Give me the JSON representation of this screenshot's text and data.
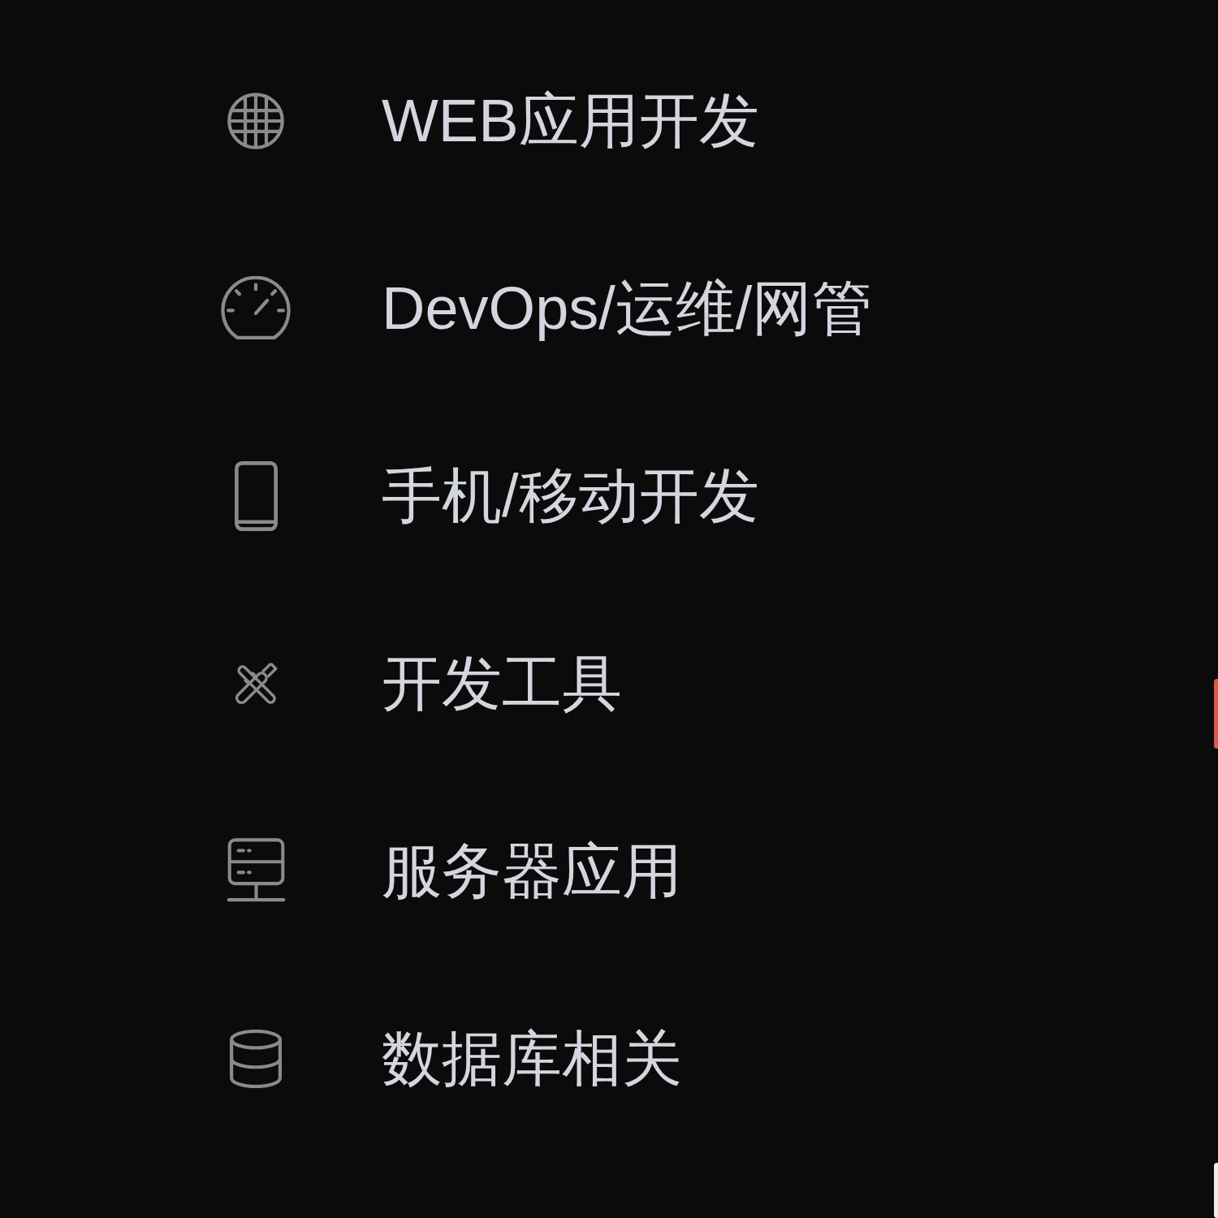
{
  "menu": {
    "items": [
      {
        "label": "WEB应用开发"
      },
      {
        "label": "DevOps/运维/网管"
      },
      {
        "label": "手机/移动开发"
      },
      {
        "label": "开发工具"
      },
      {
        "label": "服务器应用"
      },
      {
        "label": "数据库相关"
      }
    ]
  }
}
